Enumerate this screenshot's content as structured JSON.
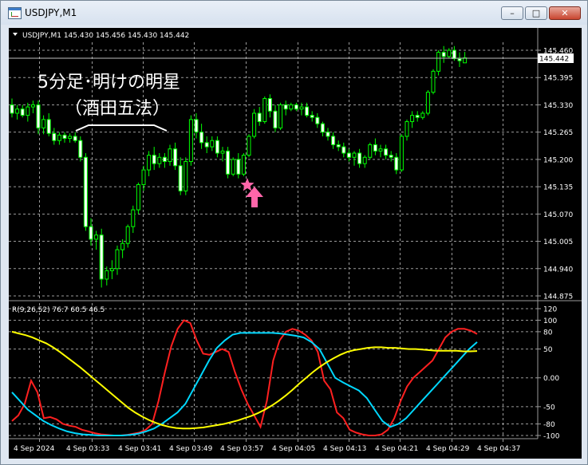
{
  "window": {
    "title": "USDJPY,M1",
    "minimize_icon": "minimize-icon",
    "maximize_icon": "maximize-icon",
    "close_icon": "close-icon"
  },
  "chart_data": [
    {
      "type": "candlestick",
      "header": "USDJPY,M1  145.430 145.456 145.430 145.442",
      "header_icon": "triangle-down-icon",
      "annotation_line1": "5分足･明けの明星",
      "annotation_line2": "（酒田五法）",
      "markers": [
        "star-marker",
        "arrow-up-icon"
      ],
      "current_price_label": "145.442",
      "ylim": [
        144.875,
        145.47
      ],
      "y_ticks": [
        "145.460",
        "145.395",
        "145.330",
        "145.265",
        "145.200",
        "145.135",
        "145.070",
        "145.005",
        "144.940",
        "144.875"
      ],
      "grid": true,
      "colors": {
        "background": "#000000",
        "candles": "#00ff00",
        "grid": "#9a9a9a",
        "marker": "#ff66aa",
        "price_line": "#c0c0c0"
      },
      "ohlc": [
        [
          145.33,
          145.345,
          145.3,
          145.31
        ],
        [
          145.31,
          145.33,
          145.295,
          145.32
        ],
        [
          145.32,
          145.33,
          145.3,
          145.305
        ],
        [
          145.305,
          145.335,
          145.29,
          145.325
        ],
        [
          145.325,
          145.34,
          145.31,
          145.33
        ],
        [
          145.33,
          145.34,
          145.26,
          145.275
        ],
        [
          145.275,
          145.305,
          145.26,
          145.295
        ],
        [
          145.295,
          145.31,
          145.255,
          145.262
        ],
        [
          145.262,
          145.275,
          145.235,
          145.245
        ],
        [
          145.245,
          145.265,
          145.235,
          145.258
        ],
        [
          145.258,
          145.265,
          145.24,
          145.25
        ],
        [
          145.25,
          145.262,
          145.24,
          145.255
        ],
        [
          145.255,
          145.265,
          145.24,
          145.245
        ],
        [
          145.245,
          145.255,
          145.195,
          145.205
        ],
        [
          145.205,
          145.215,
          145.03,
          145.04
        ],
        [
          145.04,
          145.06,
          144.995,
          145.01
        ],
        [
          145.01,
          145.03,
          144.985,
          145.02
        ],
        [
          145.02,
          145.035,
          144.895,
          144.915
        ],
        [
          144.915,
          144.945,
          144.9,
          144.935
        ],
        [
          144.935,
          144.96,
          144.915,
          144.94
        ],
        [
          144.94,
          144.995,
          144.925,
          144.985
        ],
        [
          144.985,
          145.01,
          144.965,
          145.0
        ],
        [
          145.0,
          145.045,
          144.99,
          145.04
        ],
        [
          145.04,
          145.09,
          145.025,
          145.08
        ],
        [
          145.08,
          145.145,
          145.07,
          145.14
        ],
        [
          145.14,
          145.185,
          145.125,
          145.175
        ],
        [
          145.175,
          145.22,
          145.16,
          145.21
        ],
        [
          145.21,
          145.23,
          145.175,
          145.19
        ],
        [
          145.19,
          145.215,
          145.18,
          145.205
        ],
        [
          145.205,
          145.215,
          145.18,
          145.195
        ],
        [
          145.195,
          145.235,
          145.185,
          145.225
        ],
        [
          145.225,
          145.24,
          145.175,
          145.185
        ],
        [
          145.185,
          145.205,
          145.115,
          145.125
        ],
        [
          145.125,
          145.205,
          145.115,
          145.195
        ],
        [
          145.195,
          145.305,
          145.185,
          145.295
        ],
        [
          145.295,
          145.31,
          145.25,
          145.265
        ],
        [
          145.265,
          145.285,
          145.225,
          145.24
        ],
        [
          145.24,
          145.255,
          145.215,
          145.23
        ],
        [
          145.23,
          145.255,
          145.22,
          145.245
        ],
        [
          145.245,
          145.255,
          145.205,
          145.215
        ],
        [
          145.215,
          145.23,
          145.195,
          145.22
        ],
        [
          145.22,
          145.23,
          145.155,
          145.165
        ],
        [
          145.165,
          145.205,
          145.16,
          145.2
        ],
        [
          145.2,
          145.215,
          145.155,
          145.165
        ],
        [
          145.165,
          145.215,
          145.16,
          145.21
        ],
        [
          145.21,
          145.26,
          145.205,
          145.255
        ],
        [
          145.255,
          145.32,
          145.25,
          145.31
        ],
        [
          145.31,
          145.325,
          145.28,
          145.29
        ],
        [
          145.29,
          145.35,
          145.285,
          145.345
        ],
        [
          145.345,
          145.355,
          145.3,
          145.315
        ],
        [
          145.315,
          145.33,
          145.265,
          145.275
        ],
        [
          145.275,
          145.335,
          145.27,
          145.33
        ],
        [
          145.33,
          145.34,
          145.305,
          145.32
        ],
        [
          145.32,
          145.335,
          145.315,
          145.33
        ],
        [
          145.33,
          145.335,
          145.315,
          145.32
        ],
        [
          145.32,
          145.335,
          145.305,
          145.325
        ],
        [
          145.325,
          145.335,
          145.3,
          145.305
        ],
        [
          145.305,
          145.315,
          145.29,
          145.3
        ],
        [
          145.3,
          145.31,
          145.275,
          145.285
        ],
        [
          145.285,
          145.29,
          145.255,
          145.265
        ],
        [
          145.265,
          145.275,
          145.245,
          145.255
        ],
        [
          145.255,
          145.265,
          145.225,
          145.235
        ],
        [
          145.235,
          145.245,
          145.22,
          145.23
        ],
        [
          145.23,
          145.24,
          145.205,
          145.215
        ],
        [
          145.215,
          145.225,
          145.195,
          145.205
        ],
        [
          145.205,
          145.22,
          145.185,
          145.215
        ],
        [
          145.215,
          145.225,
          145.18,
          145.19
        ],
        [
          145.19,
          145.21,
          145.18,
          145.205
        ],
        [
          145.205,
          145.24,
          145.2,
          145.235
        ],
        [
          145.235,
          145.25,
          145.21,
          145.22
        ],
        [
          145.22,
          145.235,
          145.205,
          145.225
        ],
        [
          145.225,
          145.235,
          145.2,
          145.21
        ],
        [
          145.21,
          145.22,
          145.195,
          145.205
        ],
        [
          145.205,
          145.215,
          145.165,
          145.175
        ],
        [
          145.175,
          145.26,
          145.17,
          145.255
        ],
        [
          145.255,
          145.295,
          145.245,
          145.29
        ],
        [
          145.29,
          145.315,
          145.275,
          145.305
        ],
        [
          145.305,
          145.315,
          145.29,
          145.3
        ],
        [
          145.3,
          145.315,
          145.295,
          145.31
        ],
        [
          145.31,
          145.365,
          145.305,
          145.36
        ],
        [
          145.36,
          145.415,
          145.355,
          145.41
        ],
        [
          145.41,
          145.46,
          145.4,
          145.455
        ],
        [
          145.455,
          145.47,
          145.43,
          145.445
        ],
        [
          145.445,
          145.465,
          145.44,
          145.46
        ],
        [
          145.46,
          145.47,
          145.435,
          145.44
        ],
        [
          145.44,
          145.455,
          145.42,
          145.435
        ],
        [
          145.43,
          145.456,
          145.43,
          145.442
        ]
      ],
      "x_ticks": [
        "4 Sep 2024",
        "4 Sep 03:33",
        "4 Sep 03:41",
        "4 Sep 03:49",
        "4 Sep 03:57",
        "4 Sep 04:05",
        "4 Sep 04:13",
        "4 Sep 04:21",
        "4 Sep 04:29",
        "4 Sep 04:37"
      ]
    },
    {
      "type": "line",
      "header": "R(9,26,52) 76.7 60.5 46.5",
      "ylim": [
        -105,
        125
      ],
      "y_ticks": [
        120,
        100,
        80,
        50,
        "0.00",
        -50,
        -80,
        -100
      ],
      "grid": true,
      "colors": {
        "grid": "#9a9a9a"
      },
      "series": [
        {
          "color": "#ff2020",
          "values": [
            -75,
            -65,
            -45,
            -5,
            -25,
            -70,
            -68,
            -72,
            -80,
            -83,
            -85,
            -90,
            -93,
            -96,
            -98,
            -99,
            -100,
            -100,
            -99,
            -97,
            -95,
            -90,
            -80,
            -40,
            10,
            55,
            85,
            100,
            95,
            65,
            42,
            40,
            45,
            50,
            45,
            10,
            -20,
            -45,
            -65,
            -85,
            -40,
            30,
            65,
            80,
            85,
            82,
            75,
            65,
            45,
            -5,
            -20,
            -60,
            -70,
            -90,
            -95,
            -98,
            -100,
            -100,
            -98,
            -90,
            -70,
            -40,
            -15,
            0,
            10,
            20,
            30,
            50,
            70,
            80,
            85,
            85,
            82,
            76
          ]
        },
        {
          "color": "#00d8ff",
          "values": [
            -25,
            -40,
            -55,
            -65,
            -75,
            -82,
            -88,
            -93,
            -96,
            -98,
            -99,
            -100,
            -100,
            -100,
            -100,
            -99,
            -97,
            -93,
            -88,
            -80,
            -70,
            -60,
            -45,
            -20,
            5,
            30,
            52,
            65,
            75,
            78,
            78,
            78,
            78,
            78,
            77,
            75,
            73,
            70,
            62,
            50,
            25,
            0,
            -8,
            -15,
            -22,
            -35,
            -55,
            -75,
            -85,
            -80,
            -70,
            -55,
            -40,
            -25,
            -10,
            5,
            20,
            35,
            50,
            62
          ]
        },
        {
          "color": "#ffff00",
          "values": [
            80,
            77,
            74,
            70,
            65,
            60,
            53,
            45,
            36,
            27,
            18,
            8,
            -2,
            -12,
            -22,
            -32,
            -42,
            -52,
            -60,
            -67,
            -73,
            -78,
            -82,
            -85,
            -87,
            -88,
            -88,
            -87,
            -86,
            -84,
            -82,
            -80,
            -77,
            -74,
            -70,
            -66,
            -61,
            -55,
            -48,
            -40,
            -31,
            -21,
            -10,
            0,
            10,
            19,
            27,
            34,
            40,
            45,
            48,
            50,
            52,
            53,
            53,
            52,
            52,
            51,
            50,
            50,
            49,
            48,
            47,
            47,
            47,
            47,
            46,
            46,
            46.5
          ]
        }
      ],
      "x_ticks": [
        "4 Sep 2024",
        "4 Sep 03:33",
        "4 Sep 03:41",
        "4 Sep 03:49",
        "4 Sep 03:57",
        "4 Sep 04:05",
        "4 Sep 04:13",
        "4 Sep 04:21",
        "4 Sep 04:29",
        "4 Sep 04:37"
      ]
    }
  ]
}
